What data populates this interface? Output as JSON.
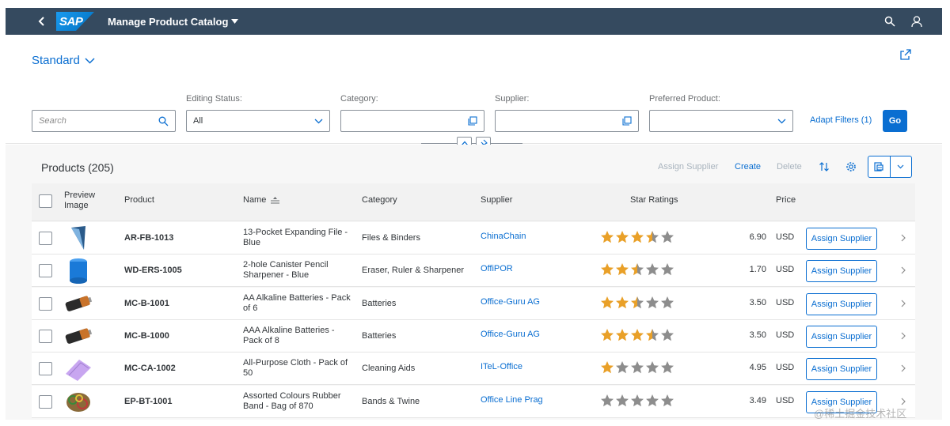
{
  "shell": {
    "logo_text": "SAP",
    "app_title": "Manage Product Catalog"
  },
  "header": {
    "variant": "Standard"
  },
  "filters": {
    "search_placeholder": "Search",
    "editing_status_label": "Editing Status:",
    "editing_status_value": "All",
    "category_label": "Category:",
    "supplier_label": "Supplier:",
    "preferred_product_label": "Preferred Product:",
    "adapt_filters": "Adapt Filters (1)",
    "go": "Go"
  },
  "table": {
    "title": "Products (205)",
    "toolbar": {
      "assign_supplier": "Assign Supplier",
      "create": "Create",
      "delete": "Delete"
    },
    "columns": {
      "preview_line1": "Preview",
      "preview_line2": "Image",
      "product": "Product",
      "name": "Name",
      "category": "Category",
      "supplier": "Supplier",
      "star_ratings": "Star Ratings",
      "price": "Price"
    },
    "assign_button_label": "Assign Supplier",
    "rows": [
      {
        "product": "AR-FB-1013",
        "name_line1": "13-Pocket Expanding File -",
        "name_line2": "Blue",
        "category": "Files & Binders",
        "supplier": "ChinaChain",
        "rating": 3.5,
        "price": "6.90",
        "currency": "USD",
        "image": "file-folder-icon"
      },
      {
        "product": "WD-ERS-1005",
        "name_line1": "2-hole Canister Pencil",
        "name_line2": "Sharpener - Blue",
        "category": "Eraser, Ruler & Sharpener",
        "supplier": "OffiPOR",
        "rating": 2.5,
        "price": "1.70",
        "currency": "USD",
        "image": "pencil-sharpener-icon"
      },
      {
        "product": "MC-B-1001",
        "name_line1": "AA Alkaline Batteries - Pack",
        "name_line2": "of 6",
        "category": "Batteries",
        "supplier": "Office-Guru AG",
        "rating": 2.5,
        "price": "3.50",
        "currency": "USD",
        "image": "battery-icon"
      },
      {
        "product": "MC-B-1000",
        "name_line1": "AAA Alkaline Batteries -",
        "name_line2": "Pack of 8",
        "category": "Batteries",
        "supplier": "Office-Guru AG",
        "rating": 3.5,
        "price": "3.50",
        "currency": "USD",
        "image": "battery-icon"
      },
      {
        "product": "MC-CA-1002",
        "name_line1": "All-Purpose Cloth - Pack of",
        "name_line2": "50",
        "category": "Cleaning Aids",
        "supplier": "ITeL-Office",
        "rating": 1,
        "price": "4.95",
        "currency": "USD",
        "image": "cloth-icon"
      },
      {
        "product": "EP-BT-1001",
        "name_line1": "Assorted Colours Rubber",
        "name_line2": "Band - Bag of 870",
        "category": "Bands & Twine",
        "supplier": "Office Line Prag",
        "rating": 0,
        "price": "3.49",
        "currency": "USD",
        "image": "rubber-bands-icon"
      }
    ]
  },
  "watermark": "@稀土掘金技术社区",
  "colors": {
    "shell": "#354a5f",
    "accent": "#0a6ed1",
    "star_filled": "#e9a028",
    "star_empty": "#8d8d8d"
  }
}
